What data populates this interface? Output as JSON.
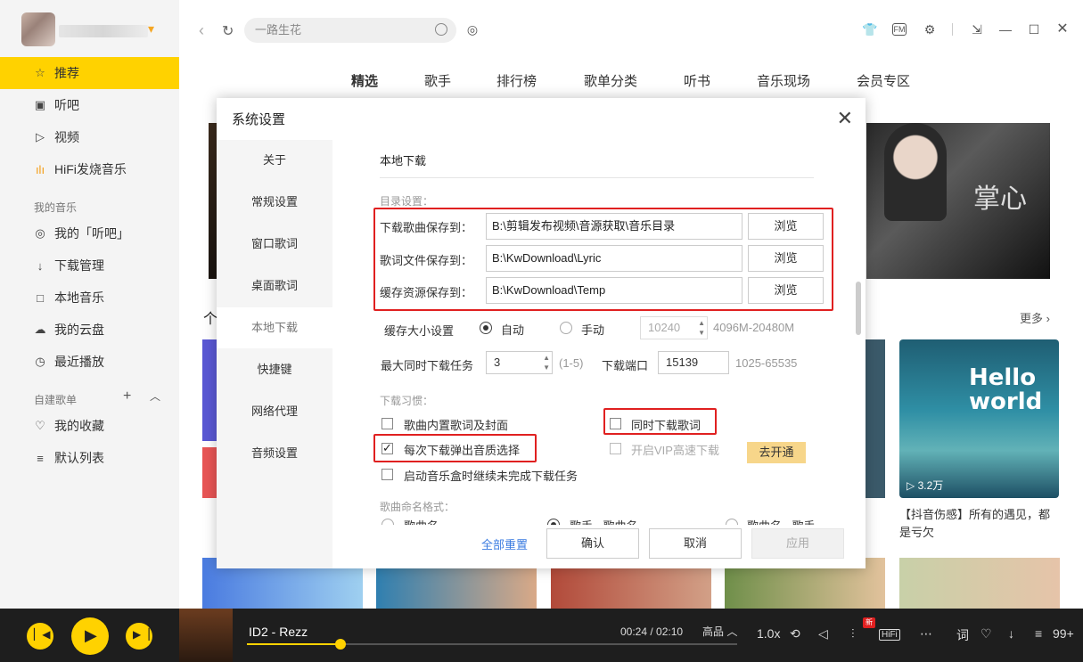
{
  "sidebar": {
    "items": [
      {
        "label": "推荐",
        "icon": "star-icon"
      },
      {
        "label": "听吧",
        "icon": "radio-icon"
      },
      {
        "label": "视频",
        "icon": "video-icon"
      },
      {
        "label": "HiFi发烧音乐",
        "icon": "hifi-icon"
      }
    ],
    "my_music_title": "我的音乐",
    "my_music": [
      {
        "label": "我的「听吧」",
        "icon": "podcast-icon"
      },
      {
        "label": "下载管理",
        "icon": "download-icon"
      },
      {
        "label": "本地音乐",
        "icon": "monitor-icon"
      },
      {
        "label": "我的云盘",
        "icon": "cloud-icon"
      },
      {
        "label": "最近播放",
        "icon": "clock-icon"
      }
    ],
    "playlist_title": "自建歌单",
    "playlists": [
      {
        "label": "我的收藏",
        "icon": "heart-icon"
      },
      {
        "label": "默认列表",
        "icon": "list-icon"
      }
    ]
  },
  "header": {
    "search_placeholder": "一路生花"
  },
  "tabs": [
    "精选",
    "歌手",
    "排行榜",
    "歌单分类",
    "听书",
    "音乐现场",
    "会员专区"
  ],
  "content": {
    "more": "更多",
    "hello_cover_text": "Hello world",
    "hello_plays": "3.2万",
    "hello_title": "【抖音伤感】所有的遇见，都是亏欠"
  },
  "dialog": {
    "title": "系统设置",
    "menu": [
      "关于",
      "常规设置",
      "窗口歌词",
      "桌面歌词",
      "本地下载",
      "快捷键",
      "网络代理",
      "音频设置"
    ],
    "section_title": "本地下载",
    "dir_settings": "目录设置：",
    "paths": [
      {
        "label": "下载歌曲保存到：",
        "value": "B:\\剪辑发布视频\\音源获取\\音乐目录",
        "browse": "浏览"
      },
      {
        "label": "歌词文件保存到：",
        "value": "B:\\KwDownload\\Lyric",
        "browse": "浏览"
      },
      {
        "label": "缓存资源保存到：",
        "value": "B:\\KwDownload\\Temp",
        "browse": "浏览"
      }
    ],
    "cache_size_label": "缓存大小设置",
    "cache_auto": "自动",
    "cache_manual": "手动",
    "cache_value": "10240",
    "cache_range": "4096M-20480M",
    "max_tasks_label": "最大同时下载任务",
    "max_tasks_value": "3",
    "max_tasks_range": "(1-5)",
    "port_label": "下载端口",
    "port_value": "15139",
    "port_range": "1025-65535",
    "habit_title": "下载习惯：",
    "opt_embed": "歌曲内置歌词及封面",
    "opt_lyrics": "同时下载歌词",
    "opt_quality": "每次下载弹出音质选择",
    "opt_vip": "开启VIP高速下载",
    "vip_btn": "去开通",
    "opt_resume": "启动音乐盒时继续未完成下载任务",
    "naming_title": "歌曲命名格式：",
    "naming_opts": [
      "歌曲名",
      "歌手 - 歌曲名",
      "歌曲名 - 歌手"
    ],
    "reset": "全部重置",
    "confirm": "确认",
    "cancel": "取消",
    "apply": "应用"
  },
  "player": {
    "song": "ID2 - Rezz",
    "time": "00:24 / 02:10",
    "quality": "高品",
    "speed": "1.0x",
    "hifi": "HiFi",
    "badge_new": "新",
    "lyric": "词",
    "count": "99+",
    "progress": 0.19
  }
}
